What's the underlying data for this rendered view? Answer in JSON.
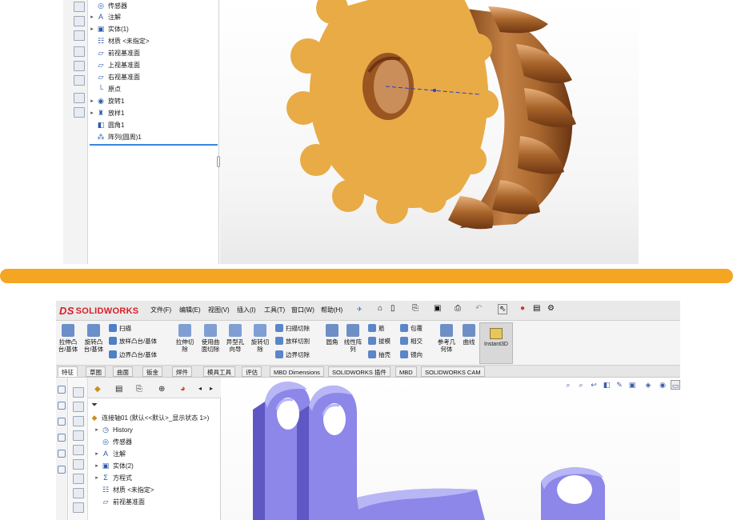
{
  "top": {
    "tree": [
      {
        "label": "传感器",
        "icon": "sensor-icon",
        "arrow": ""
      },
      {
        "label": "注解",
        "icon": "annotation-icon",
        "arrow": "▸"
      },
      {
        "label": "实体(1)",
        "icon": "solid-bodies-icon",
        "arrow": "▸"
      },
      {
        "label": "材质 <未指定>",
        "icon": "material-icon",
        "arrow": ""
      },
      {
        "label": "前视基准面",
        "icon": "plane-icon",
        "arrow": ""
      },
      {
        "label": "上视基准面",
        "icon": "plane-icon",
        "arrow": ""
      },
      {
        "label": "右视基准面",
        "icon": "plane-icon",
        "arrow": ""
      },
      {
        "label": "原点",
        "icon": "origin-icon",
        "arrow": ""
      },
      {
        "label": "旋转1",
        "icon": "revolve-icon",
        "arrow": "▸"
      },
      {
        "label": "放样1",
        "icon": "loft-icon",
        "arrow": "▸"
      },
      {
        "label": "圆角1",
        "icon": "fillet-icon",
        "arrow": ""
      },
      {
        "label": "阵列(圆周)1",
        "icon": "circular-pattern-icon",
        "arrow": ""
      }
    ],
    "colors": {
      "gear_face": "#e8ab46",
      "gear_side": "#a8672e",
      "highlight": "#d9a273"
    }
  },
  "bottom": {
    "logo": {
      "ds": "DS",
      "text": "SOLIDWORKS"
    },
    "menu": [
      "文件(F)",
      "编辑(E)",
      "视图(V)",
      "插入(I)",
      "工具(T)",
      "窗口(W)",
      "帮助(H)"
    ],
    "ribbon": {
      "extrude_boss": "拉伸凸\n台/基体",
      "revolve_boss": "旋转凸\n台/基体",
      "sweep": "扫描",
      "loft_boss": "放样凸台/基体",
      "boundary_boss": "边界凸台/基体",
      "extrude_cut": "拉伸切\n除",
      "surface_cut": "使用曲\n面切除",
      "hole_wizard": "异型孔\n向导",
      "revolve_cut": "旋转切\n除",
      "sweep_cut": "扫描切除",
      "loft_cut": "放样切割",
      "boundary_cut": "边界切除",
      "fillet": "圆角",
      "linear_pattern": "线性阵\n列",
      "rib": "筋",
      "draft": "拔模",
      "shell": "抽壳",
      "wrap": "包覆",
      "intersect": "相交",
      "mirror": "镜向",
      "ref_geometry": "参考几\n何体",
      "curves": "曲线",
      "instant3d": "Instant3D"
    },
    "tabs": [
      "特征",
      "草图",
      "曲面",
      "钣金",
      "焊件",
      "模具工具",
      "评估",
      "MBD Dimensions",
      "SOLIDWORKS 插件",
      "MBD",
      "SOLIDWORKS CAM"
    ],
    "tree": [
      {
        "label": "连接轴01 (默认<<默认>_显示状态 1>)",
        "icon": "part-icon",
        "arrow": ""
      },
      {
        "label": "History",
        "icon": "history-icon",
        "arrow": "▸"
      },
      {
        "label": "传感器",
        "icon": "sensor-icon",
        "arrow": ""
      },
      {
        "label": "注解",
        "icon": "annotation-icon",
        "arrow": "▸"
      },
      {
        "label": "实体(2)",
        "icon": "solid-bodies-icon",
        "arrow": "▸"
      },
      {
        "label": "方程式",
        "icon": "equation-icon",
        "arrow": "▸"
      },
      {
        "label": "材质 <未指定>",
        "icon": "material-icon",
        "arrow": ""
      },
      {
        "label": "前视基准面",
        "icon": "plane-icon",
        "arrow": ""
      }
    ],
    "colors": {
      "part": "#8c87e8",
      "part_dark": "#5e58c4",
      "part_light": "#b9b6f5"
    }
  }
}
